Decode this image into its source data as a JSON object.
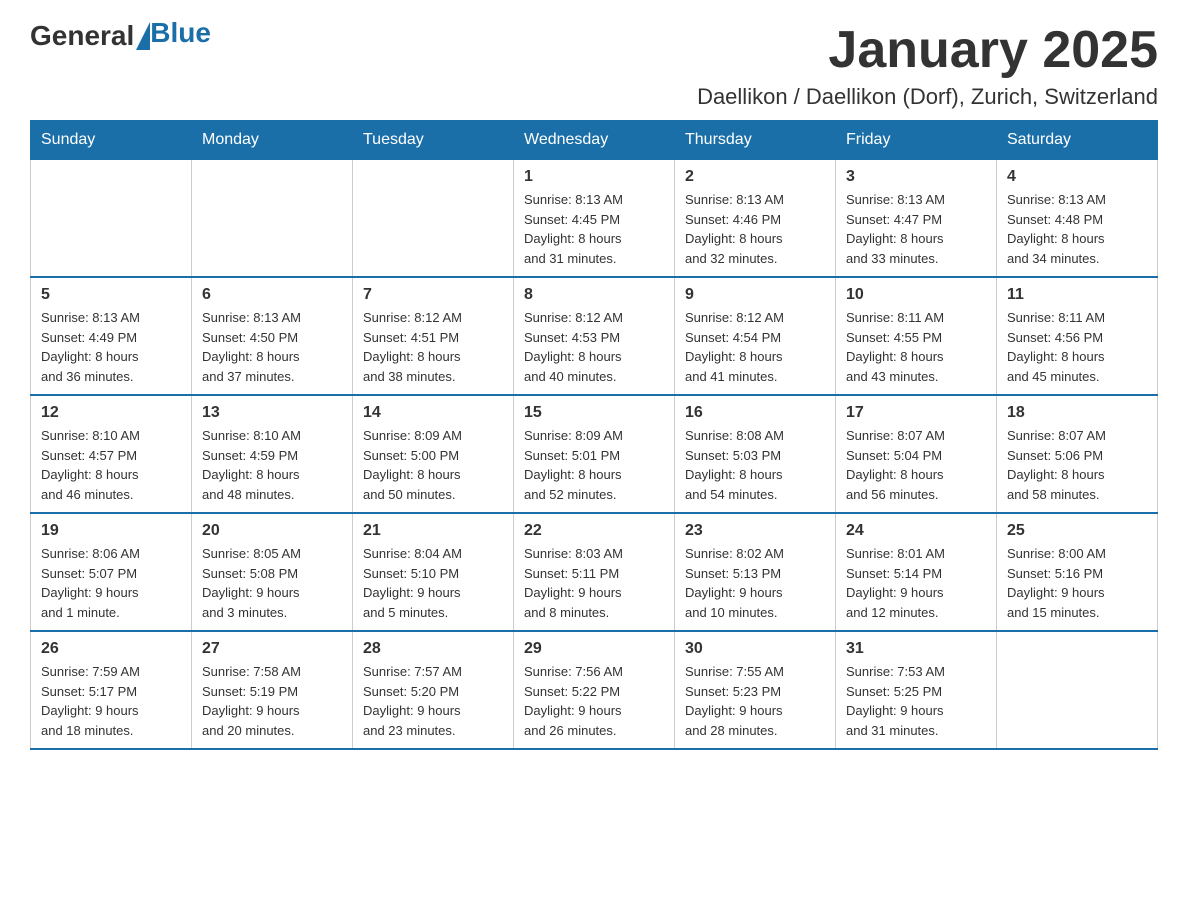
{
  "logo": {
    "general": "General",
    "blue": "Blue"
  },
  "title": "January 2025",
  "location": "Daellikon / Daellikon (Dorf), Zurich, Switzerland",
  "days_of_week": [
    "Sunday",
    "Monday",
    "Tuesday",
    "Wednesday",
    "Thursday",
    "Friday",
    "Saturday"
  ],
  "weeks": [
    [
      {
        "day": "",
        "info": ""
      },
      {
        "day": "",
        "info": ""
      },
      {
        "day": "",
        "info": ""
      },
      {
        "day": "1",
        "info": "Sunrise: 8:13 AM\nSunset: 4:45 PM\nDaylight: 8 hours\nand 31 minutes."
      },
      {
        "day": "2",
        "info": "Sunrise: 8:13 AM\nSunset: 4:46 PM\nDaylight: 8 hours\nand 32 minutes."
      },
      {
        "day": "3",
        "info": "Sunrise: 8:13 AM\nSunset: 4:47 PM\nDaylight: 8 hours\nand 33 minutes."
      },
      {
        "day": "4",
        "info": "Sunrise: 8:13 AM\nSunset: 4:48 PM\nDaylight: 8 hours\nand 34 minutes."
      }
    ],
    [
      {
        "day": "5",
        "info": "Sunrise: 8:13 AM\nSunset: 4:49 PM\nDaylight: 8 hours\nand 36 minutes."
      },
      {
        "day": "6",
        "info": "Sunrise: 8:13 AM\nSunset: 4:50 PM\nDaylight: 8 hours\nand 37 minutes."
      },
      {
        "day": "7",
        "info": "Sunrise: 8:12 AM\nSunset: 4:51 PM\nDaylight: 8 hours\nand 38 minutes."
      },
      {
        "day": "8",
        "info": "Sunrise: 8:12 AM\nSunset: 4:53 PM\nDaylight: 8 hours\nand 40 minutes."
      },
      {
        "day": "9",
        "info": "Sunrise: 8:12 AM\nSunset: 4:54 PM\nDaylight: 8 hours\nand 41 minutes."
      },
      {
        "day": "10",
        "info": "Sunrise: 8:11 AM\nSunset: 4:55 PM\nDaylight: 8 hours\nand 43 minutes."
      },
      {
        "day": "11",
        "info": "Sunrise: 8:11 AM\nSunset: 4:56 PM\nDaylight: 8 hours\nand 45 minutes."
      }
    ],
    [
      {
        "day": "12",
        "info": "Sunrise: 8:10 AM\nSunset: 4:57 PM\nDaylight: 8 hours\nand 46 minutes."
      },
      {
        "day": "13",
        "info": "Sunrise: 8:10 AM\nSunset: 4:59 PM\nDaylight: 8 hours\nand 48 minutes."
      },
      {
        "day": "14",
        "info": "Sunrise: 8:09 AM\nSunset: 5:00 PM\nDaylight: 8 hours\nand 50 minutes."
      },
      {
        "day": "15",
        "info": "Sunrise: 8:09 AM\nSunset: 5:01 PM\nDaylight: 8 hours\nand 52 minutes."
      },
      {
        "day": "16",
        "info": "Sunrise: 8:08 AM\nSunset: 5:03 PM\nDaylight: 8 hours\nand 54 minutes."
      },
      {
        "day": "17",
        "info": "Sunrise: 8:07 AM\nSunset: 5:04 PM\nDaylight: 8 hours\nand 56 minutes."
      },
      {
        "day": "18",
        "info": "Sunrise: 8:07 AM\nSunset: 5:06 PM\nDaylight: 8 hours\nand 58 minutes."
      }
    ],
    [
      {
        "day": "19",
        "info": "Sunrise: 8:06 AM\nSunset: 5:07 PM\nDaylight: 9 hours\nand 1 minute."
      },
      {
        "day": "20",
        "info": "Sunrise: 8:05 AM\nSunset: 5:08 PM\nDaylight: 9 hours\nand 3 minutes."
      },
      {
        "day": "21",
        "info": "Sunrise: 8:04 AM\nSunset: 5:10 PM\nDaylight: 9 hours\nand 5 minutes."
      },
      {
        "day": "22",
        "info": "Sunrise: 8:03 AM\nSunset: 5:11 PM\nDaylight: 9 hours\nand 8 minutes."
      },
      {
        "day": "23",
        "info": "Sunrise: 8:02 AM\nSunset: 5:13 PM\nDaylight: 9 hours\nand 10 minutes."
      },
      {
        "day": "24",
        "info": "Sunrise: 8:01 AM\nSunset: 5:14 PM\nDaylight: 9 hours\nand 12 minutes."
      },
      {
        "day": "25",
        "info": "Sunrise: 8:00 AM\nSunset: 5:16 PM\nDaylight: 9 hours\nand 15 minutes."
      }
    ],
    [
      {
        "day": "26",
        "info": "Sunrise: 7:59 AM\nSunset: 5:17 PM\nDaylight: 9 hours\nand 18 minutes."
      },
      {
        "day": "27",
        "info": "Sunrise: 7:58 AM\nSunset: 5:19 PM\nDaylight: 9 hours\nand 20 minutes."
      },
      {
        "day": "28",
        "info": "Sunrise: 7:57 AM\nSunset: 5:20 PM\nDaylight: 9 hours\nand 23 minutes."
      },
      {
        "day": "29",
        "info": "Sunrise: 7:56 AM\nSunset: 5:22 PM\nDaylight: 9 hours\nand 26 minutes."
      },
      {
        "day": "30",
        "info": "Sunrise: 7:55 AM\nSunset: 5:23 PM\nDaylight: 9 hours\nand 28 minutes."
      },
      {
        "day": "31",
        "info": "Sunrise: 7:53 AM\nSunset: 5:25 PM\nDaylight: 9 hours\nand 31 minutes."
      },
      {
        "day": "",
        "info": ""
      }
    ]
  ]
}
